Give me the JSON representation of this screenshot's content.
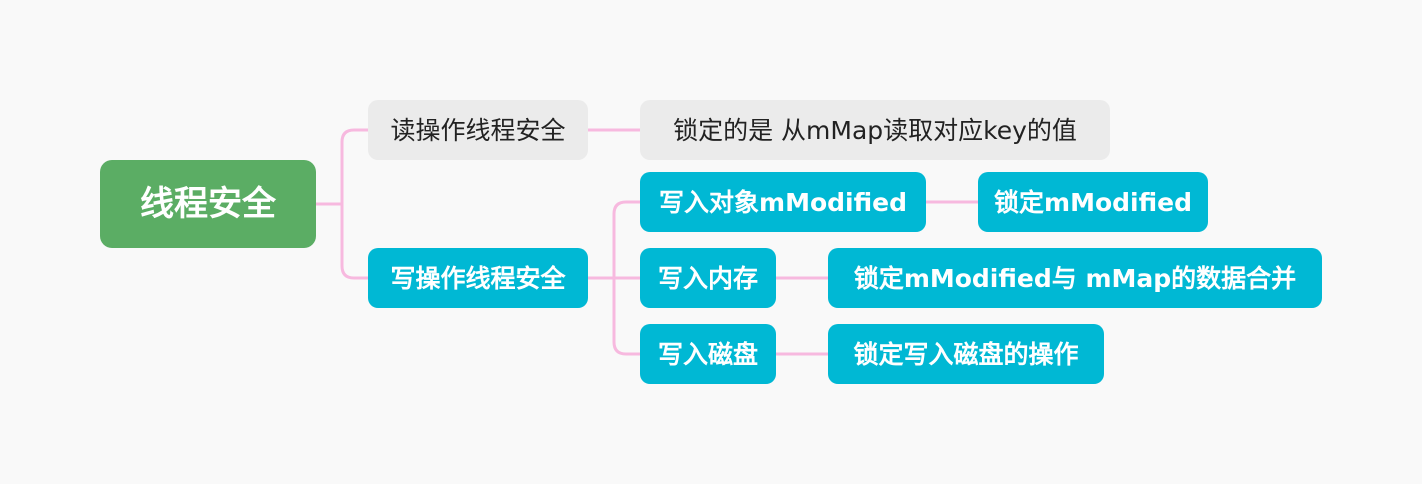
{
  "mindmap": {
    "root": {
      "label": "线程安全"
    },
    "read_branch": {
      "label": "读操作线程安全",
      "detail": "锁定的是 从mMap读取对应key的值"
    },
    "write_branch": {
      "label": "写操作线程安全",
      "steps": [
        {
          "label": "写入对象mModified",
          "detail": "锁定mModified"
        },
        {
          "label": "写入内存",
          "detail": "锁定mModified与 mMap的数据合并"
        },
        {
          "label": "写入磁盘",
          "detail": "锁定写入磁盘的操作"
        }
      ]
    },
    "colors": {
      "background": "#f9f9f9",
      "root": "#5bad64",
      "read_nodes": "#ebebeb",
      "write_nodes": "#00b8d4",
      "connector": "#f7b9df"
    }
  }
}
